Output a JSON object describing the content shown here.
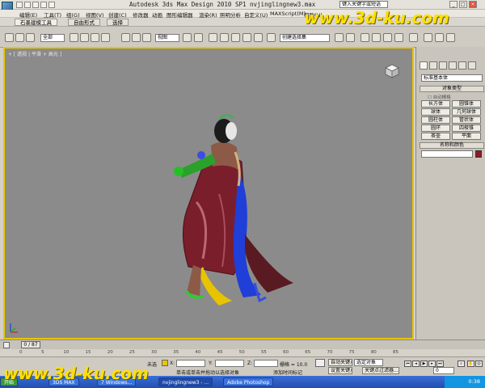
{
  "window": {
    "title": "Autodesk 3ds Max Design 2010 SP1    nvjinglingnew3.max",
    "search_placeholder": "键入关键字或短语"
  },
  "menu": [
    "编辑(E)",
    "工具(T)",
    "组(G)",
    "视图(V)",
    "创建(C)",
    "修改器",
    "动画",
    "图形编辑器",
    "渲染(R)",
    "照明分析",
    "自定义(U)",
    "MAXScript(M)",
    "帮助(H)"
  ],
  "ribbon_tabs": [
    "石墨建模工具",
    "自由形式",
    "选择"
  ],
  "toolbar": {
    "filter_value": "全部",
    "refcoord_value": "视图",
    "named_sel_placeholder": "创建选择集"
  },
  "viewport": {
    "label": "+ [ 透视 | 平滑 + 高光 ]",
    "accent": "#e8c600"
  },
  "command_panel": {
    "category": "标准基本体",
    "object_type_header": "对象类型",
    "autogrid": "自动栅格",
    "buttons": [
      "长方体",
      "圆锥体",
      "球体",
      "几何球体",
      "圆柱体",
      "管状体",
      "圆环",
      "四棱锥",
      "茶壶",
      "平面"
    ],
    "name_color_header": "名称和颜色",
    "object_color": "#8c1a28"
  },
  "timeline": {
    "slider": "0 / 87",
    "ticks": [
      "0",
      "5",
      "10",
      "15",
      "20",
      "25",
      "30",
      "35",
      "40",
      "45",
      "50",
      "55",
      "60",
      "65",
      "70",
      "75",
      "80",
      "85"
    ]
  },
  "statusbar": {
    "selection": "未选",
    "x_label": "X:",
    "y_label": "Y:",
    "z_label": "Z:",
    "grid": "栅格 = 10.0",
    "autokey": "自动关键点",
    "selected_dropdown": "选定对象",
    "setkey": "设置关键点",
    "keyfilters": "关键点过滤器...",
    "add_time_tag": "添加时间标记",
    "prompt": "单击或单击并拖动以选择对象",
    "frame": "0"
  },
  "taskbar": {
    "start": "开始",
    "tasks": [
      "3DS MAX",
      "7 Windows...",
      "nvjinglingnew3 - ...",
      "Adobe Photoshop"
    ],
    "clock": "0:38"
  },
  "watermarks": {
    "top": "www.3d-ku.com",
    "bottom": "www.3d-ku.com",
    "color": "#ffe000"
  }
}
